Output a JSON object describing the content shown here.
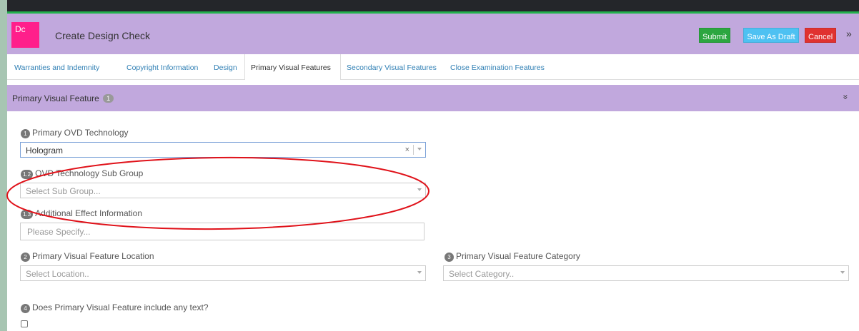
{
  "app": {
    "logo_text": "Dc",
    "title": "Create Design Check"
  },
  "actions": {
    "submit_label": "Submit",
    "save_draft_label": "Save As Draft",
    "cancel_label": "Cancel",
    "more_glyph": "»"
  },
  "tabs": [
    {
      "label": "Warranties and Indemnity"
    },
    {
      "label": "Copyright Information"
    },
    {
      "label": "Design"
    },
    {
      "label": "Primary Visual Features"
    },
    {
      "label": "Secondary Visual Features"
    },
    {
      "label": "Close Examination Features"
    }
  ],
  "active_tab_index": 3,
  "section": {
    "title": "Primary Visual Feature",
    "badge": "1",
    "collapse_glyph": "»"
  },
  "form": {
    "ovd_technology": {
      "number": "1",
      "label": "Primary OVD Technology",
      "value": "Hologram",
      "clear_glyph": "×"
    },
    "sub_group": {
      "number": "1.2",
      "label": "OVD Technology Sub Group",
      "placeholder": "Select Sub Group..."
    },
    "additional_effect": {
      "number": "1.3",
      "label": "Additional Effect Information",
      "placeholder": "Please Specify..."
    },
    "location": {
      "number": "2",
      "label": "Primary Visual Feature Location",
      "placeholder": "Select Location.."
    },
    "category": {
      "number": "3",
      "label": "Primary Visual Feature Category",
      "placeholder": "Select Category.."
    },
    "includes_text": {
      "number": "4",
      "label": "Does Primary Visual Feature include any text?",
      "checked": false
    }
  },
  "colors": {
    "header_bg": "#c1a8dd",
    "logo_bg": "#ff1f8b",
    "submit": "#2ca640",
    "save_draft": "#4ec1f2",
    "cancel": "#e0322f",
    "tab_link": "#2f7fb4",
    "annotation": "#e0121a"
  }
}
